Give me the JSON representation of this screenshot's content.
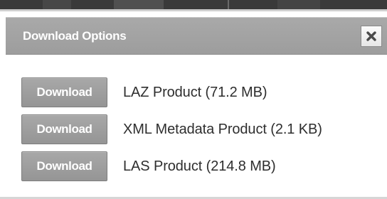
{
  "dialog": {
    "title": "Download Options",
    "close_icon": "close-x-icon"
  },
  "downloads": [
    {
      "button_label": "Download",
      "product": "LAZ Product (71.2 MB)"
    },
    {
      "button_label": "Download",
      "product": "XML Metadata Product (2.1 KB)"
    },
    {
      "button_label": "Download",
      "product": "LAS Product (214.8 MB)"
    }
  ],
  "colors": {
    "titlebar": "#a3a3a3",
    "button": "#9e9e9e",
    "text": "#2e2e2e"
  }
}
